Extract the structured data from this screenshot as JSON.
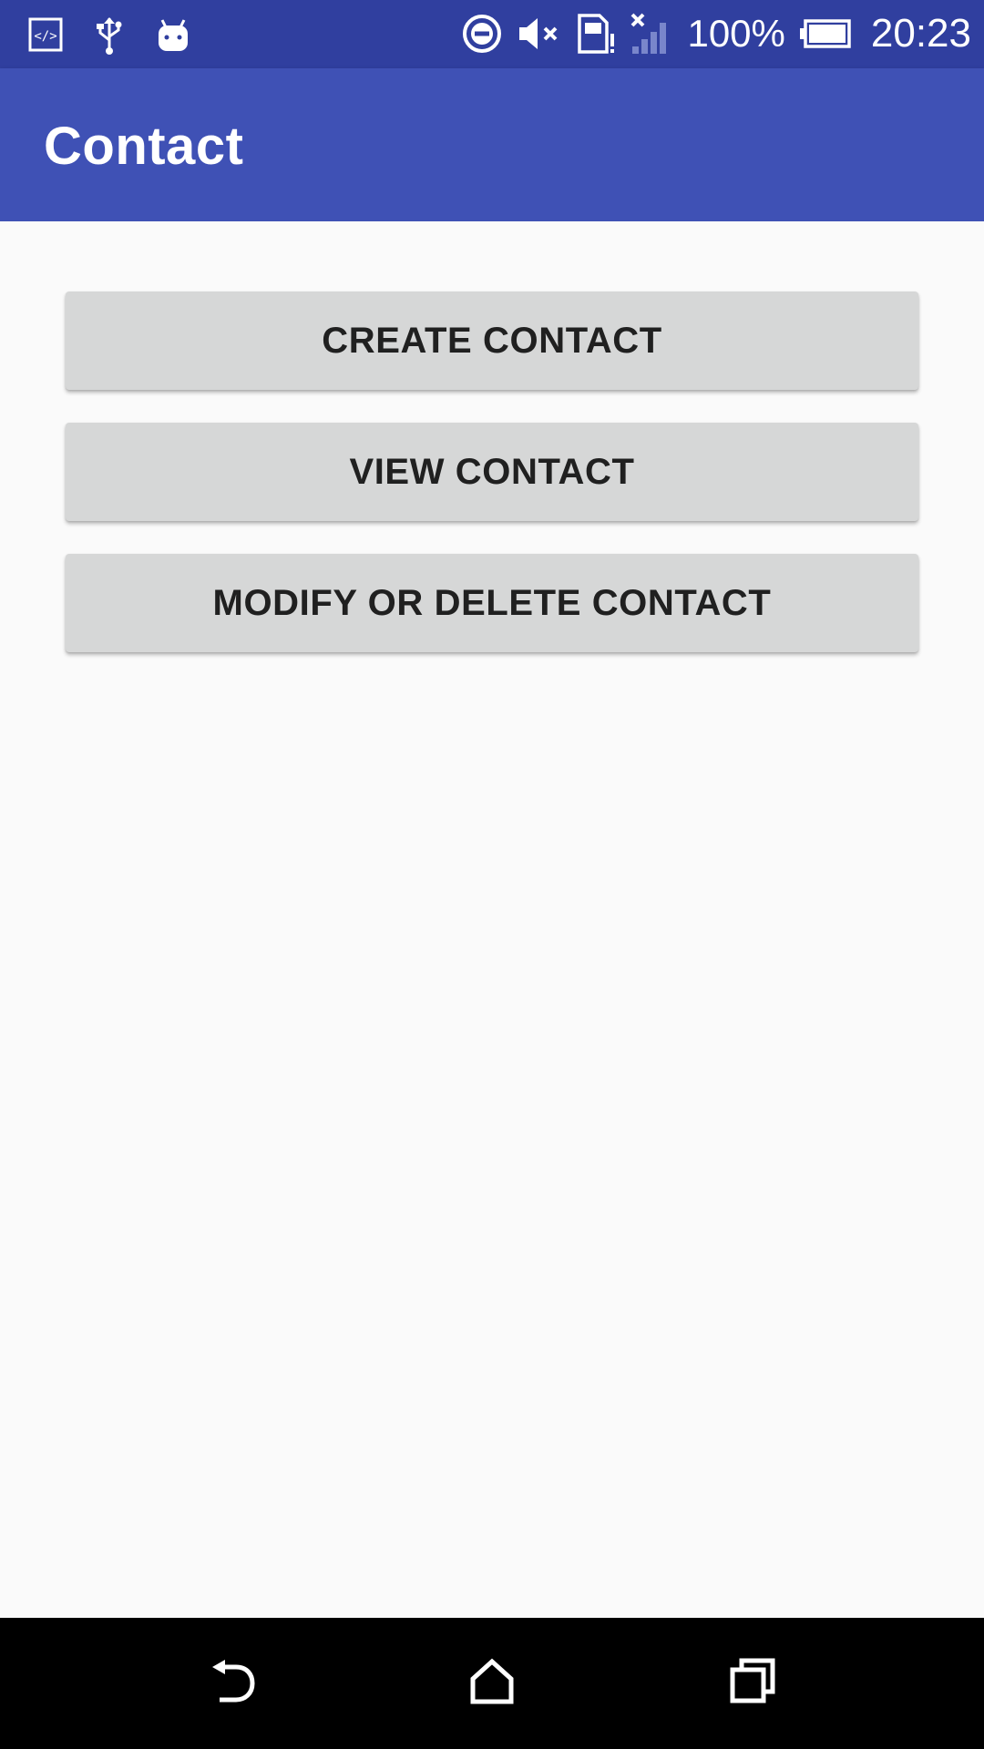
{
  "status_bar": {
    "left_icons": [
      "developer-code-icon",
      "usb-icon",
      "android-debug-icon"
    ],
    "right_icons": [
      "do-not-disturb-icon",
      "volume-muted-icon",
      "sim-alert-icon",
      "no-signal-icon",
      "battery-icon"
    ],
    "battery_percent": "100%",
    "time": "20:23"
  },
  "app_bar": {
    "title": "Contact"
  },
  "actions": {
    "create_label": "CREATE CONTACT",
    "view_label": "VIEW CONTACT",
    "modify_label": "MODIFY OR DELETE CONTACT"
  },
  "nav_bar": {
    "icons": [
      "back-icon",
      "home-icon",
      "recents-icon"
    ]
  },
  "colors": {
    "status_bar": "#303f9f",
    "app_bar": "#3f51b5",
    "button_bg": "#d6d7d7",
    "button_text": "#202020",
    "background": "#fafafa",
    "nav_bar": "#000000"
  }
}
